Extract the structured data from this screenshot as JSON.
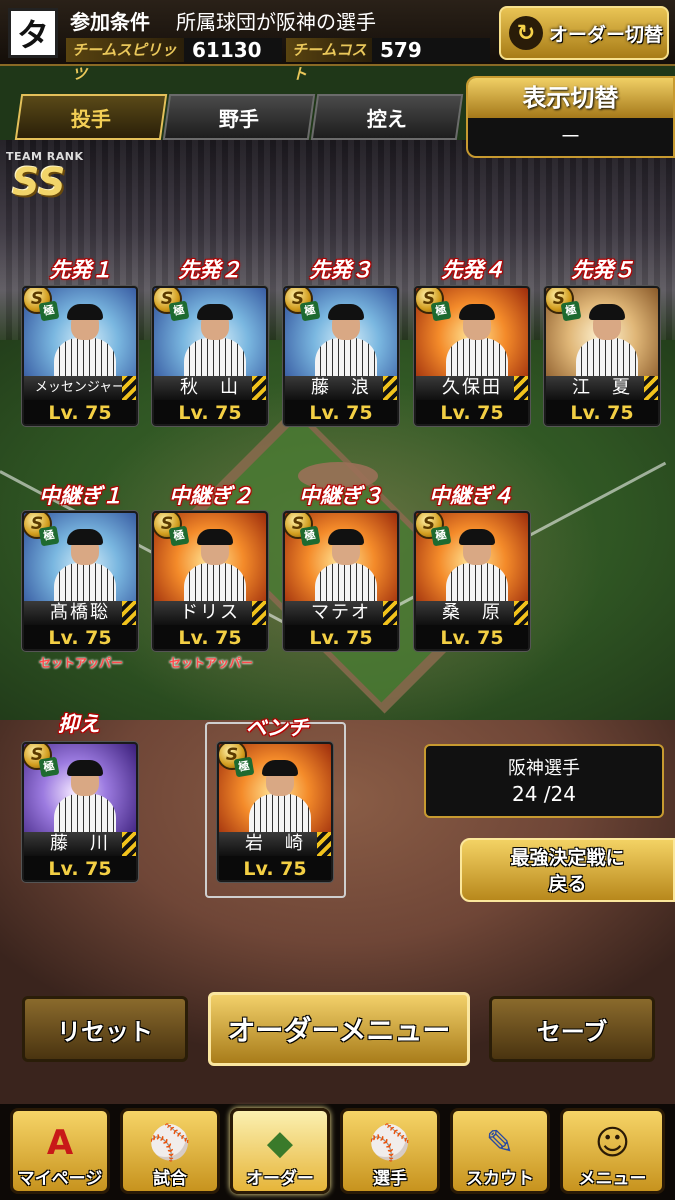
{
  "header": {
    "team_logo": "タ",
    "condition_label": "参加条件",
    "condition_value": "所属球団が阪神の選手",
    "team_spirit_label": "チームスピリッツ",
    "team_spirit_value": "61130",
    "team_cost_label": "チームコスト",
    "team_cost_value": "579",
    "order_switch_label": "オーダー切替",
    "order_switch_icon": "swap-circle-icon"
  },
  "tabs": [
    {
      "label": "投手",
      "active": true
    },
    {
      "label": "野手",
      "active": false
    },
    {
      "label": "控え",
      "active": false
    }
  ],
  "display_panel": {
    "title": "表示切替",
    "value": "－"
  },
  "team_rank": {
    "label": "TEAM RANK",
    "value": "SS"
  },
  "starters": [
    {
      "slot": "先発１",
      "name": "メッセンジャー",
      "level": "Lv. 75",
      "photo": "blue"
    },
    {
      "slot": "先発２",
      "name": "秋　山",
      "level": "Lv. 75",
      "photo": "blue"
    },
    {
      "slot": "先発３",
      "name": "藤　浪",
      "level": "Lv. 75",
      "photo": "blue"
    },
    {
      "slot": "先発４",
      "name": "久保田",
      "level": "Lv. 75",
      "photo": "fire"
    },
    {
      "slot": "先発５",
      "name": "江　夏",
      "level": "Lv. 75",
      "photo": "gold"
    }
  ],
  "relievers": [
    {
      "slot": "中継ぎ１",
      "name": "髙橋聡",
      "level": "Lv. 75",
      "role": "セットアッパー",
      "photo": "blue"
    },
    {
      "slot": "中継ぎ２",
      "name": "ドリス",
      "level": "Lv. 75",
      "role": "セットアッパー",
      "photo": "fire"
    },
    {
      "slot": "中継ぎ３",
      "name": "マテオ",
      "level": "Lv. 75",
      "role": "",
      "photo": "fire"
    },
    {
      "slot": "中継ぎ４",
      "name": "桑　原",
      "level": "Lv. 75",
      "role": "",
      "photo": "fire"
    }
  ],
  "closer": {
    "slot": "抑え",
    "name": "藤　川",
    "level": "Lv. 75",
    "photo": "violet"
  },
  "bench": {
    "slot": "ベンチ",
    "name": "岩　崎",
    "level": "Lv. 75",
    "photo": "fire"
  },
  "rarity": {
    "main": "S",
    "sub": "極"
  },
  "roster": {
    "title": "阪神選手",
    "count": "24 /24"
  },
  "back_button": {
    "line1": "最強決定戦に",
    "line2": "戻る"
  },
  "actions": {
    "reset": "リセット",
    "order_menu": "オーダーメニュー",
    "save": "セーブ"
  },
  "nav": [
    {
      "label": "マイページ",
      "icon": "A",
      "icon_name": "mypage-a-icon"
    },
    {
      "label": "試合",
      "icon": "⚾",
      "icon_name": "stadium-icon"
    },
    {
      "label": "オーダー",
      "icon": "◆",
      "icon_name": "diamond-field-icon"
    },
    {
      "label": "選手",
      "icon": "⚾",
      "icon_name": "player-icon"
    },
    {
      "label": "スカウト",
      "icon": "✎",
      "icon_name": "scout-card-icon"
    },
    {
      "label": "メニュー",
      "icon": "☺",
      "icon_name": "menu-character-icon"
    }
  ],
  "colors": {
    "accent_gold": "#e4c05a",
    "slot_label_red": "#c00000",
    "level_yellow": "#f3cf44"
  }
}
